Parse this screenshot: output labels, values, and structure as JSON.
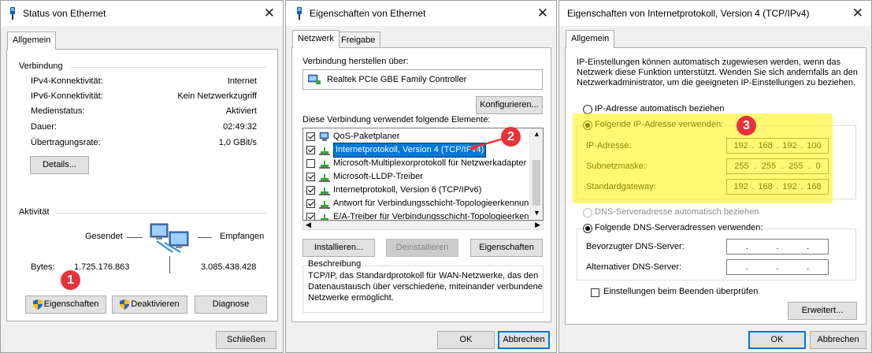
{
  "dlg1": {
    "title": "Status von Ethernet",
    "tab": "Allgemein",
    "conn_group": "Verbindung",
    "rows": [
      {
        "label": "IPv4-Konnektivität:",
        "value": "Internet"
      },
      {
        "label": "IPv6-Konnektivität:",
        "value": "Kein Netzwerkzugriff"
      },
      {
        "label": "Medienstatus:",
        "value": "Aktiviert"
      },
      {
        "label": "Dauer:",
        "value": "02:49:32"
      },
      {
        "label": "Übertragungsrate:",
        "value": "1,0 GBit/s"
      }
    ],
    "details": "Details...",
    "activity_group": "Aktivität",
    "sent": "Gesendet",
    "received": "Empfangen",
    "bytes_label": "Bytes:",
    "bytes_sent": "1.725.176.863",
    "bytes_received": "3.085.438.428",
    "btn_props": "Eigenschaften",
    "btn_deactivate": "Deaktivieren",
    "btn_diag": "Diagnose",
    "btn_close": "Schließen",
    "marker": "1"
  },
  "dlg2": {
    "title": "Eigenschaften von Ethernet",
    "tabs": [
      "Netzwerk",
      "Freigabe"
    ],
    "connect_via": "Verbindung herstellen über:",
    "adapter": "Realtek PCIe GBE Family Controller",
    "configure": "Konfigurieren...",
    "uses_label": "Diese Verbindung verwendet folgende Elemente:",
    "items": [
      {
        "label": "QoS-Paketplaner",
        "checked": true
      },
      {
        "label": "Internetprotokoll, Version 4 (TCP/IPv4)",
        "checked": true
      },
      {
        "label": "Microsoft-Multiplexorprotokoll für Netzwerkadapter",
        "checked": false
      },
      {
        "label": "Microsoft-LLDP-Treiber",
        "checked": true
      },
      {
        "label": "Internetprotokoll, Version 6 (TCP/IPv6)",
        "checked": true
      },
      {
        "label": "Antwort für Verbindungsschicht-Topologieerkennung",
        "checked": true
      },
      {
        "label": "E/A-Treiber für Verbindungsschicht-Topologieerkennur",
        "checked": true
      }
    ],
    "install": "Installieren...",
    "uninstall": "Deinstallieren",
    "properties": "Eigenschaften",
    "desc_group": "Beschreibung",
    "desc_lines": [
      "TCP/IP, das Standardprotokoll für WAN-Netzwerke, das den",
      "Datenaustausch über verschiedene, miteinander verbundene",
      "Netzwerke ermöglicht."
    ],
    "ok": "OK",
    "cancel": "Abbrechen",
    "marker": "2"
  },
  "dlg3": {
    "title": "Eigenschaften von Internetprotokoll, Version 4 (TCP/IPv4)",
    "tab": "Allgemein",
    "intro_lines": [
      "IP-Einstellungen können automatisch zugewiesen werden, wenn das",
      "Netzwerk diese Funktion unterstützt. Wenden Sie sich andernfalls an den",
      "Netzwerkadministrator, um die geeigneten IP-Einstellungen zu beziehen."
    ],
    "auto_ip": "IP-Adresse automatisch beziehen",
    "manual_ip": "Folgende IP-Adresse verwenden:",
    "ip_label": "IP-Adresse:",
    "ip": [
      "192",
      "168",
      "192",
      "100"
    ],
    "mask_label": "Subnetzmaske:",
    "mask": [
      "255",
      "255",
      "255",
      "0"
    ],
    "gw_label": "Standardgateway:",
    "gw": [
      "192",
      "168",
      "192",
      "168"
    ],
    "auto_dns": "DNS-Serveradresse automatisch beziehen",
    "manual_dns": "Folgende DNS-Serveradressen verwenden:",
    "dns1_label": "Bevorzugter DNS-Server:",
    "dns2_label": "Alternativer DNS-Server:",
    "dns_dots": [
      ".",
      ".",
      "."
    ],
    "validate": "Einstellungen beim Beenden überprüfen",
    "advanced": "Erweitert...",
    "ok": "OK",
    "cancel": "Abbrechen",
    "marker": "3"
  },
  "colors": {
    "accent": "#0078d7",
    "marker": "#e8323a",
    "highlight": "#fff200"
  }
}
